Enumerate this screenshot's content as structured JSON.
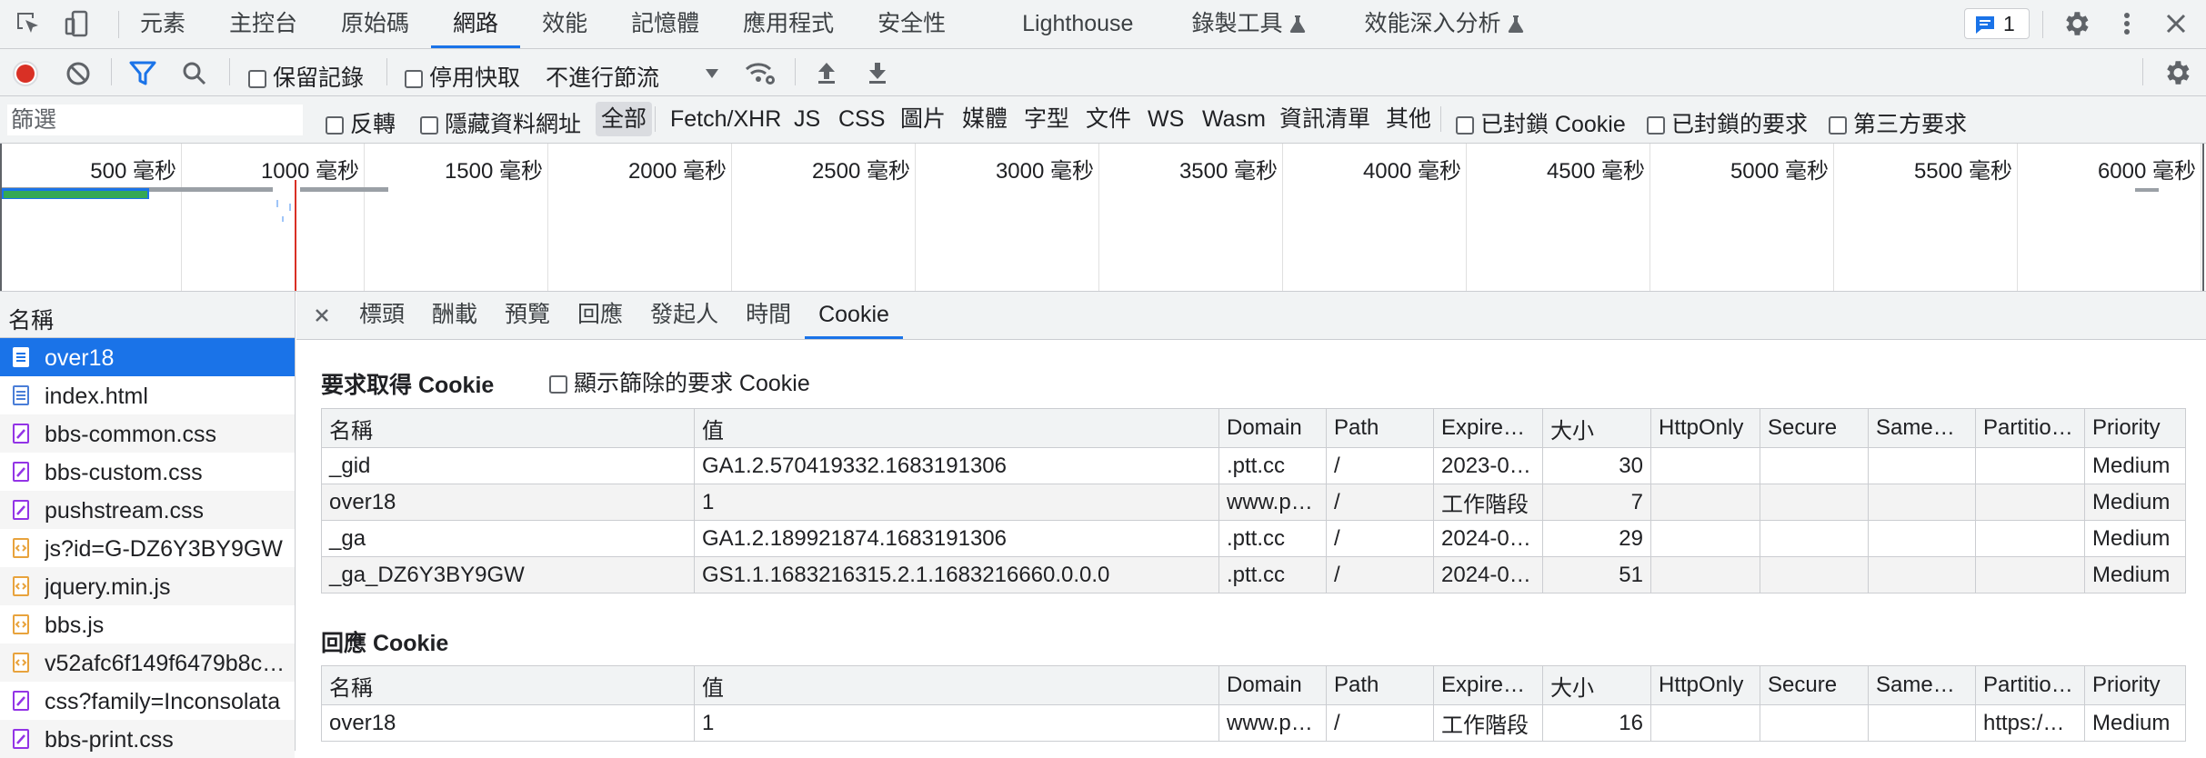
{
  "top_tabs": [
    {
      "label": "元素"
    },
    {
      "label": "主控台"
    },
    {
      "label": "原始碼"
    },
    {
      "label": "網路"
    },
    {
      "label": "效能"
    },
    {
      "label": "記憶體"
    },
    {
      "label": "應用程式"
    },
    {
      "label": "安全性"
    },
    {
      "label": "Lighthouse"
    },
    {
      "label": "錄製工具"
    },
    {
      "label": "效能深入分析"
    }
  ],
  "issues_count": "1",
  "toolbar": {
    "preserve_log": "保留記錄",
    "disable_cache": "停用快取",
    "throttling": "不進行節流"
  },
  "filter": {
    "placeholder": "篩選",
    "invert": "反轉",
    "hide_data_urls": "隱藏資料網址",
    "types": [
      "全部",
      "Fetch/XHR",
      "JS",
      "CSS",
      "圖片",
      "媒體",
      "字型",
      "文件",
      "WS",
      "Wasm",
      "資訊清單",
      "其他"
    ],
    "blocked_cookies": "已封鎖 Cookie",
    "blocked_requests": "已封鎖的要求",
    "third_party": "第三方要求"
  },
  "timeline_ticks": [
    "500 毫秒",
    "1000 毫秒",
    "1500 毫秒",
    "2000 毫秒",
    "2500 毫秒",
    "3000 毫秒",
    "3500 毫秒",
    "4000 毫秒",
    "4500 毫秒",
    "5000 毫秒",
    "5500 毫秒",
    "6000 毫秒"
  ],
  "left_header": "名稱",
  "requests": [
    {
      "name": "over18",
      "type": "doc"
    },
    {
      "name": "index.html",
      "type": "doc"
    },
    {
      "name": "bbs-common.css",
      "type": "css"
    },
    {
      "name": "bbs-custom.css",
      "type": "css"
    },
    {
      "name": "pushstream.css",
      "type": "css"
    },
    {
      "name": "js?id=G-DZ6Y3BY9GW",
      "type": "js"
    },
    {
      "name": "jquery.min.js",
      "type": "js"
    },
    {
      "name": "bbs.js",
      "type": "js"
    },
    {
      "name": "v52afc6f149f6479b8c…",
      "type": "js"
    },
    {
      "name": "css?family=Inconsolata",
      "type": "css"
    },
    {
      "name": "bbs-print.css",
      "type": "css"
    }
  ],
  "detail_tabs": [
    "標頭",
    "酬載",
    "預覽",
    "回應",
    "發起人",
    "時間",
    "Cookie"
  ],
  "request_cookies": {
    "title": "要求取得 Cookie",
    "show_filtered": "顯示篩除的要求 Cookie",
    "columns": [
      "名稱",
      "值",
      "Domain",
      "Path",
      "Expire…",
      "大小",
      "HttpOnly",
      "Secure",
      "Same…",
      "Partitio…",
      "Priority"
    ],
    "rows": [
      [
        "_gid",
        "GA1.2.570419332.1683191306",
        ".ptt.cc",
        "/",
        "2023-0…",
        "30",
        "",
        "",
        "",
        "",
        "Medium"
      ],
      [
        "over18",
        "1",
        "www.p…",
        "/",
        "工作階段",
        "7",
        "",
        "",
        "",
        "",
        "Medium"
      ],
      [
        "_ga",
        "GA1.2.189921874.1683191306",
        ".ptt.cc",
        "/",
        "2024-0…",
        "29",
        "",
        "",
        "",
        "",
        "Medium"
      ],
      [
        "_ga_DZ6Y3BY9GW",
        "GS1.1.1683216315.2.1.1683216660.0.0.0",
        ".ptt.cc",
        "/",
        "2024-0…",
        "51",
        "",
        "",
        "",
        "",
        "Medium"
      ]
    ]
  },
  "response_cookies": {
    "title": "回應 Cookie",
    "columns": [
      "名稱",
      "值",
      "Domain",
      "Path",
      "Expire…",
      "大小",
      "HttpOnly",
      "Secure",
      "Same…",
      "Partitio…",
      "Priority"
    ],
    "rows": [
      [
        "over18",
        "1",
        "www.p…",
        "/",
        "工作階段",
        "16",
        "",
        "",
        "",
        "https:/…",
        "Medium"
      ]
    ]
  },
  "colors": {
    "accent": "#1a73e8",
    "record": "#d93025",
    "panel_bg": "#f1f3f4",
    "border": "#cbcdd1"
  }
}
